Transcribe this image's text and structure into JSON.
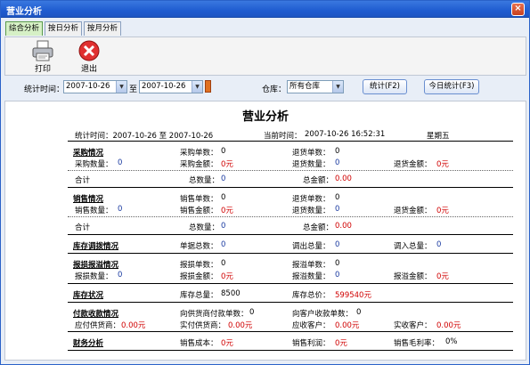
{
  "window": {
    "title": "营业分析",
    "close": "×"
  },
  "tabs": [
    "综合分析",
    "按日分析",
    "按月分析"
  ],
  "toolbar": {
    "print": "打印",
    "exit": "退出"
  },
  "filter": {
    "time_label": "统计时间：",
    "from": "2007-10-26",
    "to_label": "至",
    "to": "2007-10-26",
    "warehouse_label": "仓库：",
    "warehouse": "所有仓库",
    "stat_btn": "统计(F2)",
    "today_btn": "今日统计(F3)"
  },
  "report": {
    "title": "营业分析",
    "period_label": "统计时间：2007-10-26 至 2007-10-26",
    "now_label": "当前时间：",
    "now": "2007-10-26 16:52:31",
    "weekday": "星期五",
    "purchase": {
      "title": "采购情况",
      "order_count_label": "采购单数：",
      "order_count": "0",
      "return_count_label": "退货单数：",
      "return_count": "0",
      "qty_label": "采购数量：",
      "qty": "0",
      "amount_label": "采购金额：",
      "amount": "0元",
      "return_qty_label": "退货数量：",
      "return_qty": "0",
      "return_amount_label": "退货金额：",
      "return_amount": "0元",
      "total_label": "合计",
      "total_qty_label": "总数量：",
      "total_qty": "0",
      "total_amount_label": "总金额：",
      "total_amount": "0.00"
    },
    "sales": {
      "title": "销售情况",
      "order_count_label": "销售单数：",
      "order_count": "0",
      "return_count_label": "退货单数：",
      "return_count": "0",
      "qty_label": "销售数量：",
      "qty": "0",
      "amount_label": "销售金额：",
      "amount": "0元",
      "return_qty_label": "退货数量：",
      "return_qty": "0",
      "return_amount_label": "退货金额：",
      "return_amount": "0元",
      "total_label": "合计",
      "total_qty_label": "总数量：",
      "total_qty": "0",
      "total_amount_label": "总金额：",
      "total_amount": "0.00"
    },
    "transfer": {
      "title": "库存调拨情况",
      "count_label": "单据总数：",
      "count": "0",
      "out_label": "调出总量：",
      "out": "0",
      "in_label": "调入总量：",
      "in": "0"
    },
    "loss": {
      "title": "报损报溢情况",
      "loss_count_label": "报损单数：",
      "loss_count": "0",
      "over_count_label": "报溢单数：",
      "over_count": "0",
      "loss_qty_label": "报损数量：",
      "loss_qty": "0",
      "loss_amount_label": "报损金额：",
      "loss_amount": "0元",
      "over_qty_label": "报溢数量：",
      "over_qty": "0",
      "over_amount_label": "报溢金额：",
      "over_amount": "0元"
    },
    "stock": {
      "title": "库存状况",
      "qty_label": "库存总量：",
      "qty": "8500",
      "value_label": "库存总价：",
      "value": "599540元"
    },
    "payment": {
      "title": "付款收款情况",
      "supplier_count_label": "向供货商付款单数：",
      "supplier_count": "0",
      "customer_count_label": "向客户收款单数：",
      "customer_count": "0",
      "pay_label": "应付供货商：",
      "pay": "0.00元",
      "paid_label": "实付供货商：",
      "paid": "0.00元",
      "recv_label": "应收客户：",
      "recv": "0.00元",
      "recvd_label": "实收客户：",
      "recvd": "0.00元"
    },
    "finance": {
      "title": "财务分析",
      "cost_label": "销售成本：",
      "cost": "0元",
      "profit_label": "销售利润：",
      "profit": "0元",
      "margin_label": "销售毛利率：",
      "margin": "0%"
    }
  }
}
